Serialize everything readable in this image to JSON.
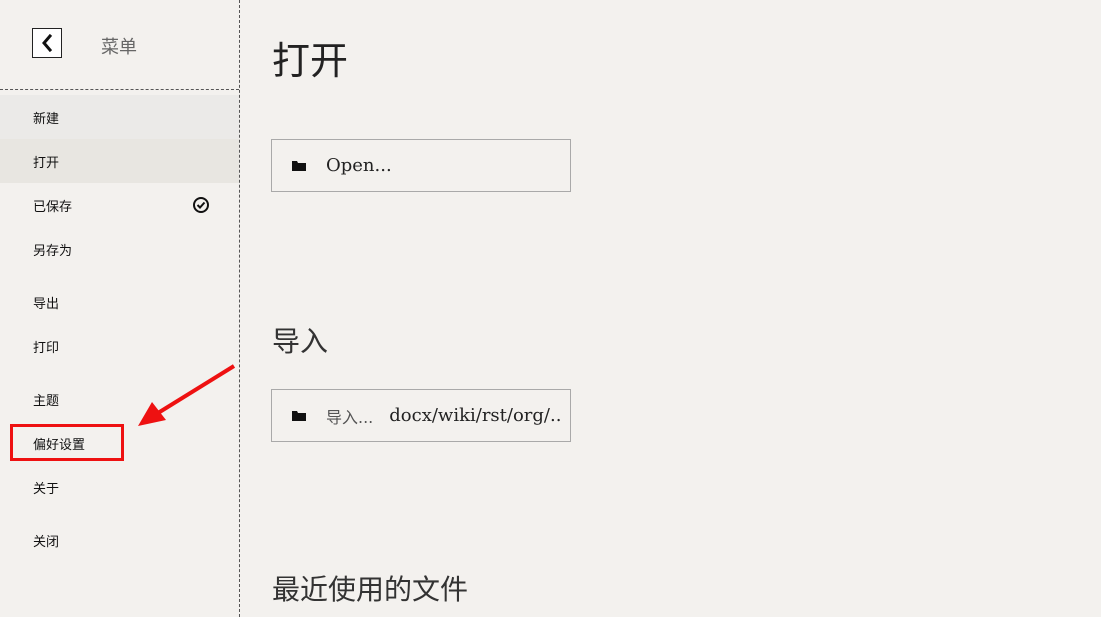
{
  "sidebar": {
    "title": "菜单",
    "back_icon": "chevron-left-icon",
    "items": [
      {
        "label": "新建"
      },
      {
        "label": "打开"
      },
      {
        "label": "已保存",
        "status_icon": "check-circle-icon"
      },
      {
        "label": "另存为"
      },
      {
        "label": "导出"
      },
      {
        "label": "打印"
      },
      {
        "label": "主题"
      },
      {
        "label": "偏好设置"
      },
      {
        "label": "关于"
      },
      {
        "label": "关闭"
      }
    ]
  },
  "main": {
    "title": "打开",
    "open_button": {
      "label": "Open...",
      "icon": "folder-icon"
    },
    "import": {
      "title": "导入",
      "button_prefix": "导入...",
      "button_formats": "docx/wiki/rst/org/..",
      "icon": "folder-icon"
    },
    "recent": {
      "title": "最近使用的文件"
    }
  },
  "annotation": {
    "color": "#ee1111"
  }
}
